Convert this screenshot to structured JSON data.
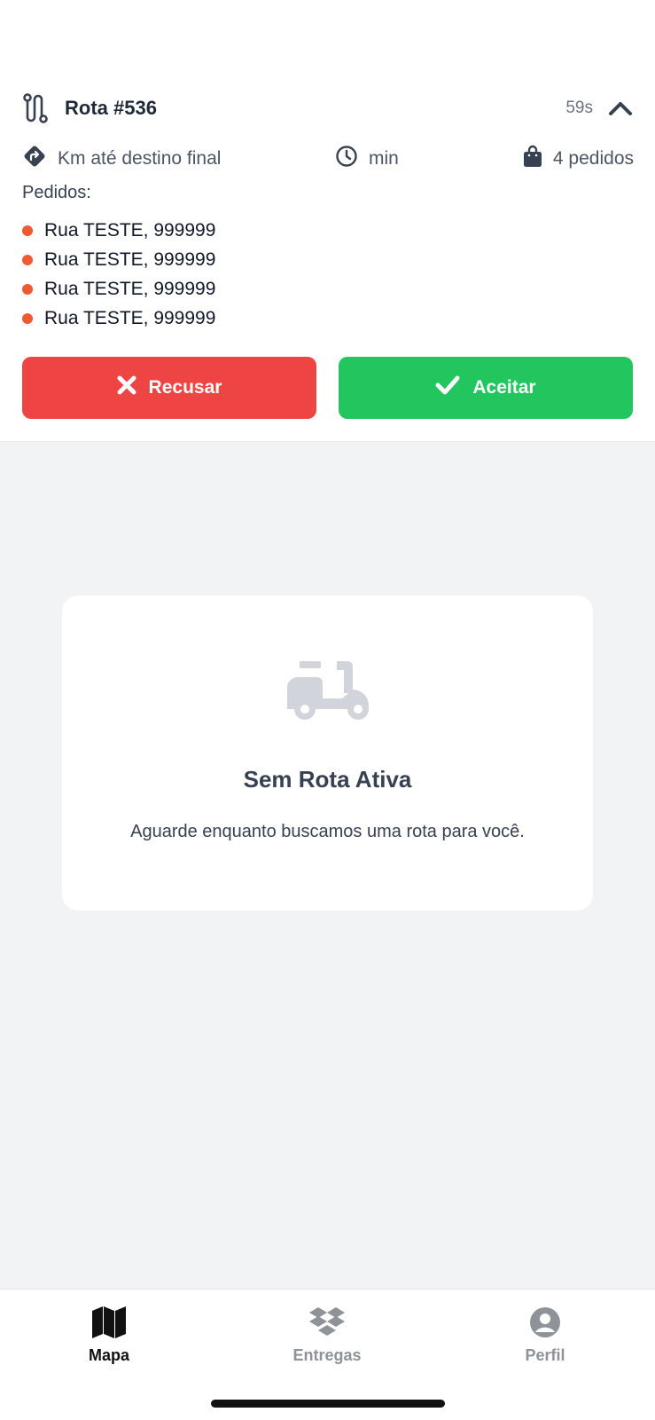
{
  "route": {
    "title": "Rota #536",
    "timer": "59s"
  },
  "stats": {
    "distance": "Km até destino final",
    "time": "min",
    "orders_count": "4 pedidos"
  },
  "orders": {
    "label": "Pedidos:",
    "items": [
      "Rua TESTE, 999999",
      "Rua TESTE, 999999",
      "Rua TESTE, 999999",
      "Rua TESTE, 999999"
    ]
  },
  "actions": {
    "reject_label": "Recusar",
    "accept_label": "Aceitar"
  },
  "empty_state": {
    "title": "Sem Rota Ativa",
    "message": "Aguarde enquanto buscamos uma rota para você."
  },
  "nav": {
    "items": [
      {
        "label": "Mapa",
        "icon": "map-icon",
        "active": true
      },
      {
        "label": "Entregas",
        "icon": "boxes-icon",
        "active": false
      },
      {
        "label": "Perfil",
        "icon": "user-circle-icon",
        "active": false
      }
    ]
  },
  "colors": {
    "reject": "#ef4444",
    "accept": "#22c55e",
    "order_dot": "#f05a33",
    "background": "#f2f3f5"
  }
}
